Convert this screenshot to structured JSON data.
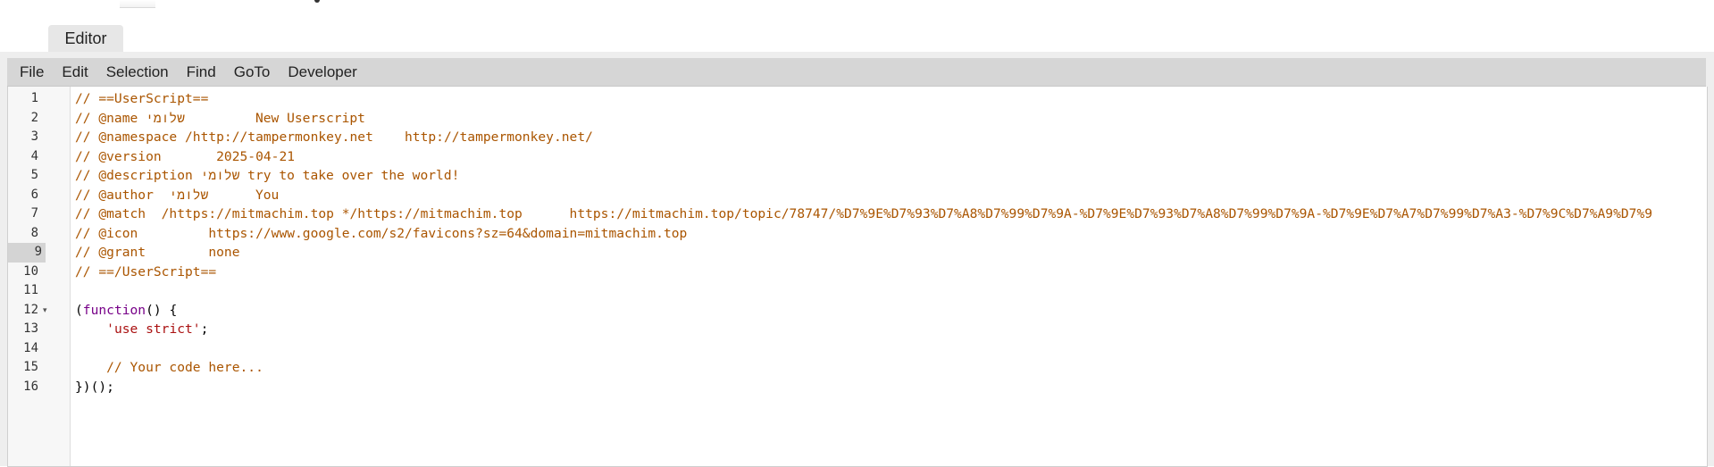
{
  "editor_tab": {
    "label": "Editor"
  },
  "menu": {
    "items": [
      "File",
      "Edit",
      "Selection",
      "Find",
      "GoTo",
      "Developer"
    ]
  },
  "editor": {
    "active_line": 9,
    "line_numbers": [
      "1",
      "2",
      "3",
      "4",
      "5",
      "6",
      "7",
      "8",
      "9",
      "10",
      "11",
      "12",
      "13",
      "14",
      "15",
      "16"
    ],
    "foldable_line": 12,
    "lines": [
      [
        {
          "t": "// ==UserScript==",
          "k": "comment"
        }
      ],
      [
        {
          "t": "// @name שלומי         New Userscript",
          "k": "comment"
        }
      ],
      [
        {
          "t": "// @namespace /http://tampermonkey.net    http://tampermonkey.net/",
          "k": "comment"
        }
      ],
      [
        {
          "t": "// @version       2025-04-21",
          "k": "comment"
        }
      ],
      [
        {
          "t": "// @description שלומי try to take over the world!",
          "k": "comment"
        }
      ],
      [
        {
          "t": "// @author  שלומי      You",
          "k": "comment"
        }
      ],
      [
        {
          "t": "// @match  /https://mitmachim.top */https://mitmachim.top      https://mitmachim.top/topic/78747/%D7%9E%D7%93%D7%A8%D7%99%D7%9A-%D7%9E%D7%93%D7%A8%D7%99%D7%9A-%D7%9E%D7%A7%D7%99%D7%A3-%D7%9C%D7%A9%D7%9",
          "k": "comment"
        }
      ],
      [
        {
          "t": "// @icon         https://www.google.com/s2/favicons?sz=64&domain=mitmachim.top",
          "k": "comment"
        }
      ],
      [
        {
          "t": "// @grant        none",
          "k": "comment"
        }
      ],
      [
        {
          "t": "// ==/UserScript==",
          "k": "comment"
        }
      ],
      [],
      [
        {
          "t": "(",
          "k": "plain"
        },
        {
          "t": "function",
          "k": "keyword"
        },
        {
          "t": "() {",
          "k": "plain"
        }
      ],
      [
        {
          "t": "    ",
          "k": "plain"
        },
        {
          "t": "'use strict'",
          "k": "string"
        },
        {
          "t": ";",
          "k": "plain"
        }
      ],
      [],
      [
        {
          "t": "    // Your code here...",
          "k": "comment"
        }
      ],
      [
        {
          "t": "})();",
          "k": "plain"
        }
      ]
    ]
  },
  "icons": {
    "fold_marker": "fold-triangle-icon"
  }
}
